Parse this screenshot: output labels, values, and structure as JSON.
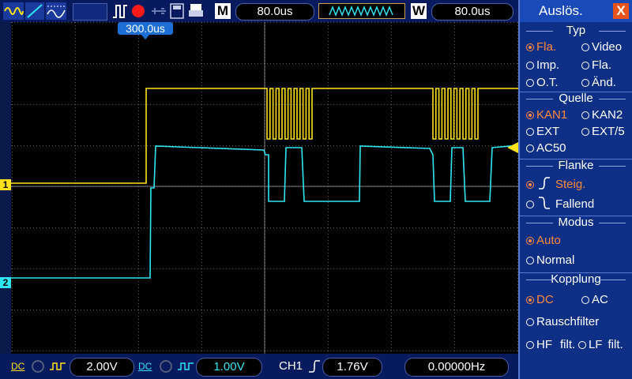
{
  "topbar": {
    "timebase": "80.0us",
    "mode_letter": "M",
    "window_letter": "W",
    "window_timebase": "80.0us",
    "trigger_position": "300.0us"
  },
  "channels": {
    "ch1_marker": "1",
    "ch2_marker": "2",
    "ch1_color": "#ffe21a",
    "ch2_color": "#2fe6f2"
  },
  "bottombar": {
    "ch1_coupling": "DC",
    "ch1_volts": "2.00V",
    "ch2_coupling": "DC",
    "ch2_volts": "1.00V",
    "trigger_source": "CH1",
    "trigger_level": "1.76V",
    "frequency": "0.00000Hz"
  },
  "menu": {
    "title": "Auslös.",
    "close_label": "X",
    "typ": {
      "title": "Typ",
      "options": [
        "Fla.",
        "Video",
        "Imp.",
        "Fla.",
        "O.T.",
        "Änd."
      ]
    },
    "quelle": {
      "title": "Quelle",
      "options": [
        "KAN1",
        "KAN2",
        "EXT",
        "EXT/5",
        "AC50"
      ]
    },
    "flanke": {
      "title": "Flanke",
      "options": [
        "Steig.",
        "Fallend"
      ]
    },
    "modus": {
      "title": "Modus",
      "options": [
        "Auto",
        "Normal"
      ]
    },
    "kopplung": {
      "title": "Kopplung",
      "options": [
        "DC",
        "AC",
        "Rauschfilter",
        "HF",
        "filt.",
        "LF",
        "filt."
      ]
    }
  }
}
